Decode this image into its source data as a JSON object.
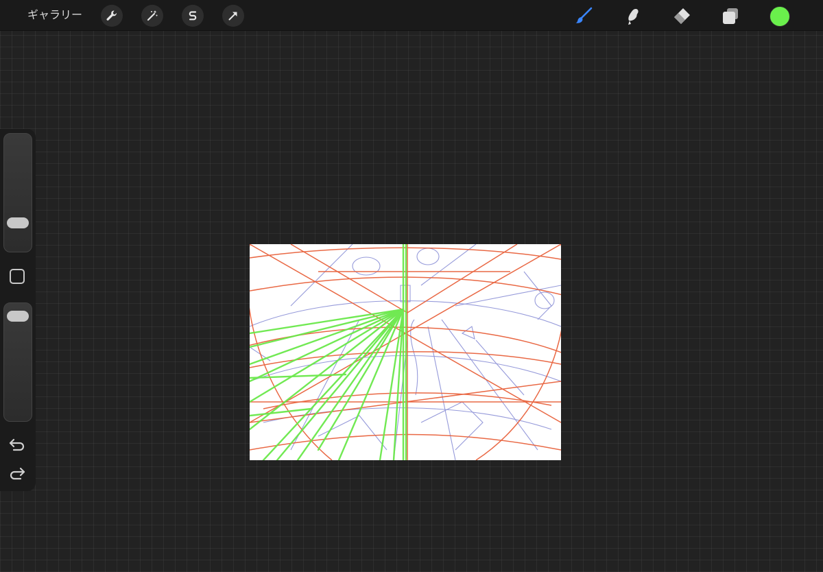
{
  "topbar": {
    "gallery_label": "ギャラリー",
    "left_tools": [
      "wrench-icon",
      "magic-wand-icon",
      "selection-s-icon",
      "transform-arrow-icon"
    ],
    "right_tools": [
      "brush-icon",
      "smudge-icon",
      "eraser-icon",
      "layers-icon"
    ],
    "active_tool": "brush-icon",
    "current_color": "#6af04c"
  },
  "sidebar": {
    "brush_size_level": 0.2,
    "opacity_level": 0.95,
    "modify_icon": "square-icon",
    "undo_icon": "undo-arrow-icon",
    "redo_icon": "redo-arrow-icon"
  },
  "canvas": {
    "stroke_colors": {
      "orange": "#e8603a",
      "blue": "#8a8fd6",
      "green": "#6ae84a"
    }
  }
}
